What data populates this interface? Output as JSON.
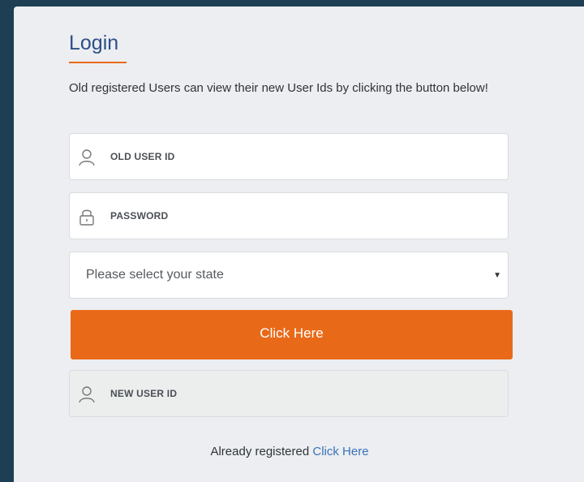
{
  "login": {
    "title": "Login",
    "intro": "Old registered Users can view their new User Ids by clicking the button below!",
    "old_user_id_placeholder": "OLD USER ID",
    "password_placeholder": "PASSWORD",
    "state_select": {
      "selected": "Please select your state"
    },
    "submit_label": "Click Here",
    "new_user_id_placeholder": "NEW USER ID",
    "footer_text": "Already registered",
    "footer_link": "Click Here"
  },
  "colors": {
    "accent": "#e86a18",
    "title": "#2d4f87",
    "link": "#3a73b8",
    "background": "#1d3e53",
    "panel": "#eceef1"
  },
  "icons": {
    "user": "user-icon",
    "lock": "lock-icon",
    "caret": "chevron-down-icon"
  }
}
